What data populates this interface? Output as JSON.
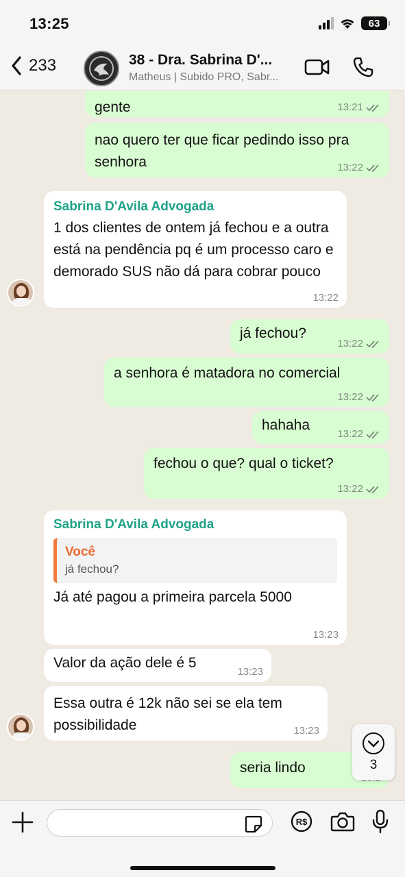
{
  "status": {
    "time": "13:25",
    "battery": "63"
  },
  "header": {
    "back_count": "233",
    "title": "38 - Dra. Sabrina D'...",
    "subtitle": "Matheus | Subido PRO, Sabr..."
  },
  "messages": [
    {
      "dir": "out",
      "text": "gente",
      "time": "13:21"
    },
    {
      "dir": "out",
      "text": "nao quero ter que ficar pedindo isso pra senhora",
      "time": "13:22"
    },
    {
      "dir": "in",
      "sender": "Sabrina D'Avila Advogada",
      "text": "1 dos clientes de ontem já fechou e a outra está na pendência pq é um processo caro e demorado SUS não dá para cobrar pouco",
      "time": "13:22"
    },
    {
      "dir": "out",
      "text": "já fechou?",
      "time": "13:22"
    },
    {
      "dir": "out",
      "text": "a senhora é matadora no comercial",
      "time": "13:22"
    },
    {
      "dir": "out",
      "text": "hahaha",
      "time": "13:22"
    },
    {
      "dir": "out",
      "text": "fechou o que? qual o ticket?",
      "time": "13:22"
    },
    {
      "dir": "in",
      "sender": "Sabrina D'Avila Advogada",
      "quote_name": "Você",
      "quote_text": "já fechou?",
      "text": "Já até pagou a primeira parcela 5000",
      "time": "13:23"
    },
    {
      "dir": "in",
      "text": "Valor da ação dele é 5",
      "time": "13:23"
    },
    {
      "dir": "in",
      "text": "Essa outra é 12k não sei se ela tem possibilidade",
      "time": "13:23"
    },
    {
      "dir": "out",
      "text": "seria lindo",
      "time": "13:2"
    }
  ],
  "scroll_down": {
    "count": "3"
  },
  "input": {
    "placeholder": ""
  },
  "colors": {
    "outgoing_bubble": "#d9fdd3",
    "incoming_bubble": "#ffffff",
    "sender_name": "#1fa287",
    "quote_accent": "#f07a3c",
    "read_ticks": "#7e8a7e"
  }
}
